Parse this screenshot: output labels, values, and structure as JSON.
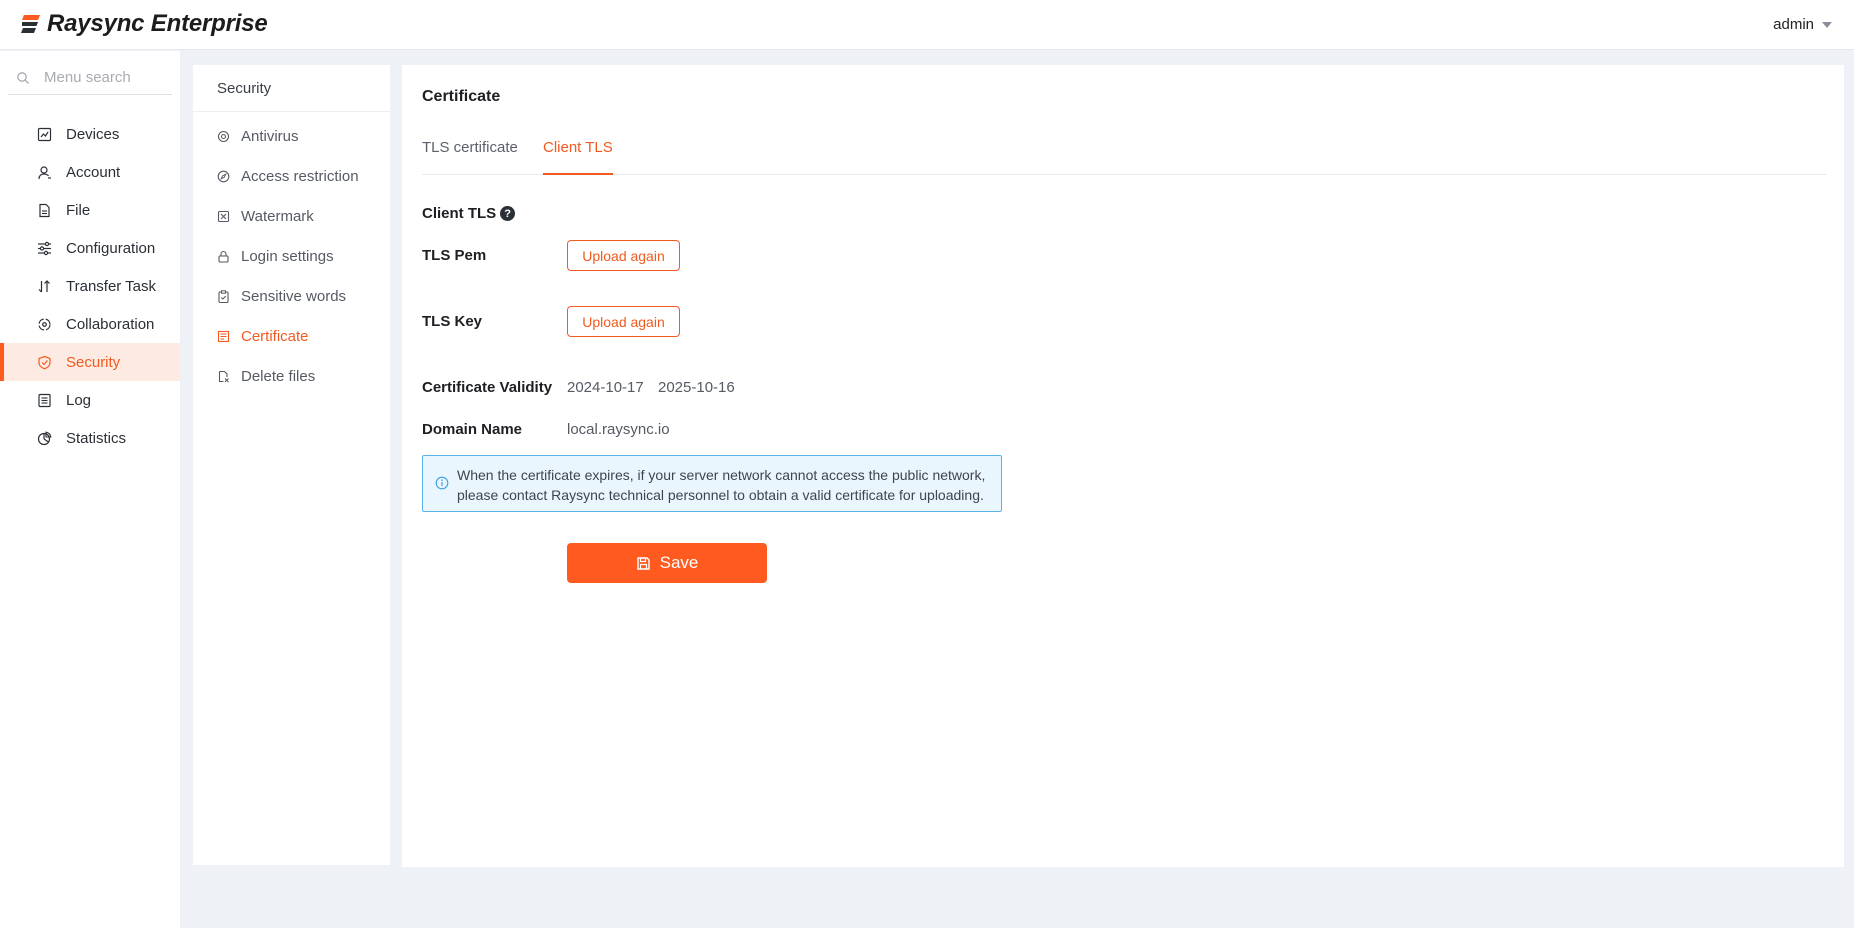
{
  "app": {
    "brand": "Raysync Enterprise",
    "user": "admin"
  },
  "colors": {
    "accent": "#f25a1f",
    "accent_bg": "#fdebe3",
    "notice_bg": "#eaf6fd",
    "notice_border": "#5ab4ea"
  },
  "sidebar": {
    "search_placeholder": "Menu search",
    "items": [
      {
        "label": "Devices",
        "icon": "devices-icon"
      },
      {
        "label": "Account",
        "icon": "user-icon"
      },
      {
        "label": "File",
        "icon": "file-icon"
      },
      {
        "label": "Configuration",
        "icon": "sliders-icon"
      },
      {
        "label": "Transfer Task",
        "icon": "transfer-icon"
      },
      {
        "label": "Collaboration",
        "icon": "collaboration-icon"
      },
      {
        "label": "Security",
        "icon": "shield-icon",
        "active": true
      },
      {
        "label": "Log",
        "icon": "log-icon"
      },
      {
        "label": "Statistics",
        "icon": "pie-chart-icon"
      }
    ]
  },
  "subnav": {
    "title": "Security",
    "items": [
      {
        "label": "Antivirus",
        "icon": "antivirus-icon"
      },
      {
        "label": "Access restriction",
        "icon": "compass-icon"
      },
      {
        "label": "Watermark",
        "icon": "watermark-icon"
      },
      {
        "label": "Login settings",
        "icon": "lock-icon"
      },
      {
        "label": "Sensitive words",
        "icon": "clipboard-icon"
      },
      {
        "label": "Certificate",
        "icon": "certificate-icon",
        "active": true
      },
      {
        "label": "Delete files",
        "icon": "delete-files-icon"
      }
    ]
  },
  "main": {
    "title": "Certificate",
    "tabs": [
      {
        "label": "TLS certificate",
        "active": false
      },
      {
        "label": "Client TLS",
        "active": true
      }
    ],
    "section_title": "Client TLS",
    "help_icon": "?",
    "tls_pem": {
      "label": "TLS Pem",
      "button": "Upload again"
    },
    "tls_key": {
      "label": "TLS Key",
      "button": "Upload again"
    },
    "validity": {
      "label": "Certificate Validity",
      "start": "2024-10-17",
      "end": "2025-10-16"
    },
    "domain": {
      "label": "Domain Name",
      "value": "local.raysync.io"
    },
    "notice": {
      "line1": "When the certificate expires, if your server network cannot access the public network,",
      "line2": "please contact Raysync technical personnel to obtain a valid certificate for uploading."
    },
    "save_label": "Save"
  }
}
